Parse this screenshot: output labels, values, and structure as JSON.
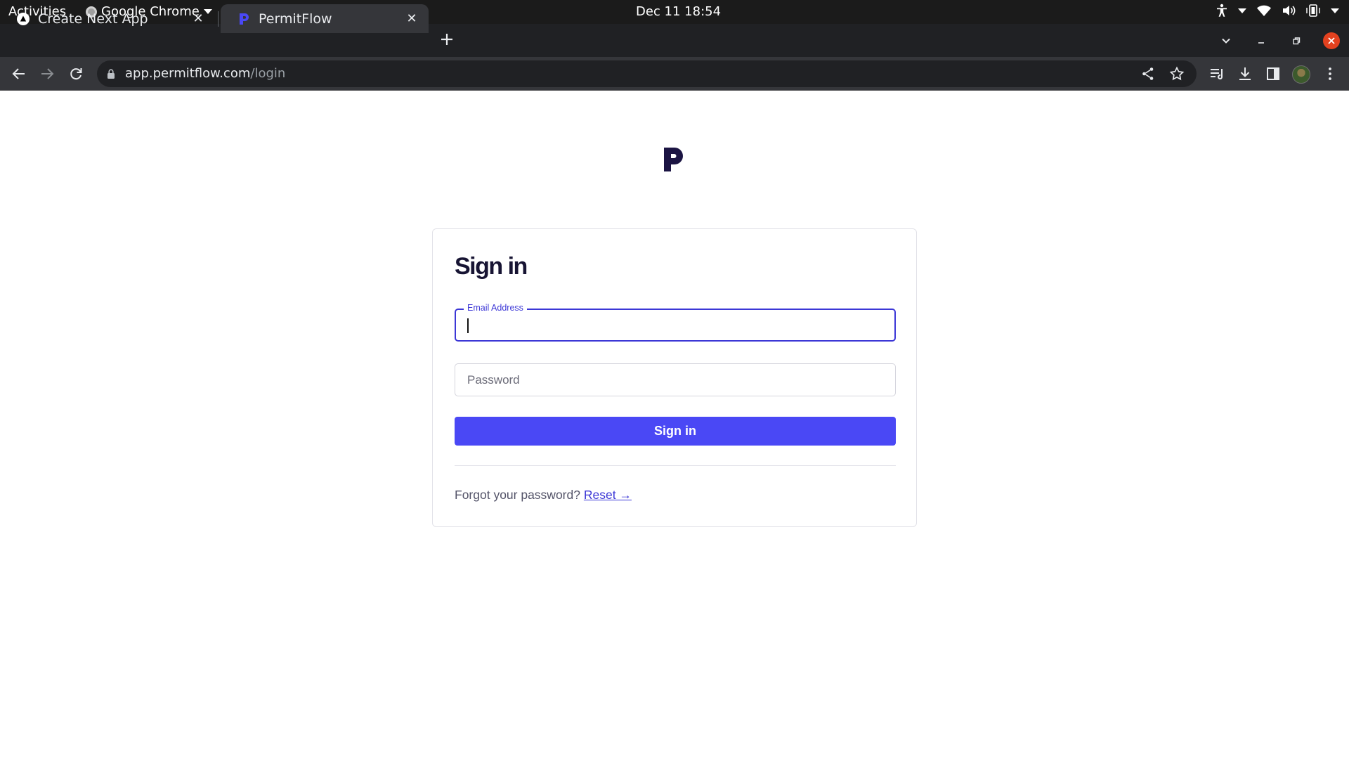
{
  "system_bar": {
    "activities": "Activities",
    "app_name": "Google Chrome",
    "clock": "Dec 11  18:54"
  },
  "tabs": [
    {
      "title": "Create Next App",
      "favicon": "nextjs-triangle-icon"
    },
    {
      "title": "PermitFlow",
      "favicon": "permitflow-logo-icon",
      "active": true
    }
  ],
  "address_bar": {
    "host": "app.permitflow.com",
    "path": "/login"
  },
  "login": {
    "title": "Sign in",
    "email_label": "Email Address",
    "email_value": "",
    "password_placeholder": "Password",
    "submit_label": "Sign in",
    "forgot_text": "Forgot your password?",
    "reset_link": "Reset →"
  },
  "colors": {
    "brand": "#4a48f5",
    "focus": "#3c37d6",
    "heading": "#171433",
    "chrome_frame": "#202124",
    "chrome_toolbar": "#35363a",
    "close_button": "#e3411f"
  }
}
